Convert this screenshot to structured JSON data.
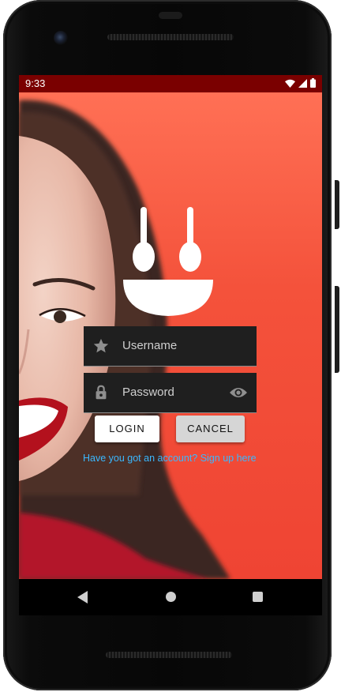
{
  "status_bar": {
    "time": "9:33",
    "icons": [
      "wifi-icon",
      "cell-signal-icon",
      "battery-icon"
    ],
    "background": "#7a0000"
  },
  "login": {
    "username_placeholder": "Username",
    "password_placeholder": "Password",
    "login_button": "LOGIN",
    "cancel_button": "CANCEL",
    "signup_link": "Have you got an account? Sign up here"
  },
  "icons": {
    "username": "star-icon",
    "password": "lock-icon",
    "visibility": "eye-icon",
    "logo": "spoons-smile-logo"
  },
  "nav_bar": {
    "buttons": [
      "back-icon",
      "home-icon",
      "recent-apps-icon"
    ]
  },
  "colors": {
    "background_top": "#ff7055",
    "background_bottom": "#ef4433",
    "field_background": "#1f1f1f",
    "link": "#3ab8ff"
  }
}
